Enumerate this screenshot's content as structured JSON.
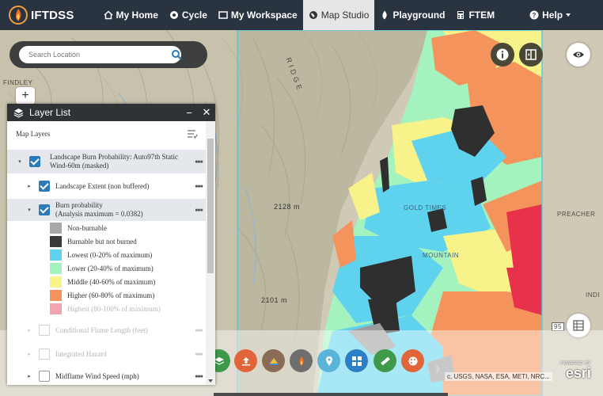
{
  "navbar": {
    "brand": "IFTDSS",
    "items": [
      {
        "label": "My Home",
        "icon": "home-icon"
      },
      {
        "label": "Cycle",
        "icon": "cycle-icon"
      },
      {
        "label": "My Workspace",
        "icon": "workspace-icon"
      },
      {
        "label": "Map Studio",
        "icon": "globe-icon",
        "active": true
      },
      {
        "label": "Playground",
        "icon": "flame-icon"
      },
      {
        "label": "FTEM",
        "icon": "calculator-icon"
      },
      {
        "label": "Help",
        "icon": "help-icon"
      }
    ]
  },
  "search": {
    "placeholder": "Search Location"
  },
  "map": {
    "labels": {
      "ridge": "R I D G E",
      "findley": "FINDLEY",
      "elev_2128": "2128 m",
      "elev_2101": "2101 m",
      "gold_times": "GOLD TIMES",
      "preacher": "PREACHER",
      "mountain": "MOUNTAIN",
      "indi": "INDI",
      "road_95": "95"
    },
    "attribution": "c, USGS, NASA, ESA, METI, NRC...",
    "esri_small": "POWERED BY",
    "esri_big": "esri"
  },
  "layer_list": {
    "title": "Layer List",
    "section": "Map Layers",
    "layers": [
      {
        "label": "Landscape Burn Probability: Auto97th Static Wind-60m (masked)",
        "checked": true
      },
      {
        "label": "Landscape Extent (non buffered)",
        "checked": true
      },
      {
        "label": "Burn probability",
        "sublabel": "(Analysis maximum = 0.0382)",
        "checked": true
      },
      {
        "label": "Conditional Flame Length (feet)",
        "checked": false
      },
      {
        "label": "Integrated Hazard",
        "checked": false
      },
      {
        "label": "Midflame Wind Speed (mph)",
        "checked": false
      }
    ],
    "legend": [
      {
        "label": "Non-burnable",
        "color": "#a8a8a8"
      },
      {
        "label": "Burnable but not burned",
        "color": "#3a3a3a"
      },
      {
        "label": "Lowest (0-20% of maximum)",
        "color": "#5fd3ee"
      },
      {
        "label": "Lower (20-40% of maximum)",
        "color": "#a4f2bd"
      },
      {
        "label": "Middle (40-60% of maximum)",
        "color": "#f7f38a"
      },
      {
        "label": "Higher (60-80% of maximum)",
        "color": "#f4935c"
      },
      {
        "label": "Highest (80-100% of maximum)",
        "color": "#f2a5b0"
      }
    ]
  },
  "colors": {
    "nav_bg": "#2a3340",
    "checkbox": "#2b7bb9",
    "burn_lowest": "#5fd3ee",
    "burn_lower": "#a4f2bd",
    "burn_middle": "#f7f38a",
    "burn_higher": "#f4935c",
    "burn_highest": "#e8314b"
  }
}
